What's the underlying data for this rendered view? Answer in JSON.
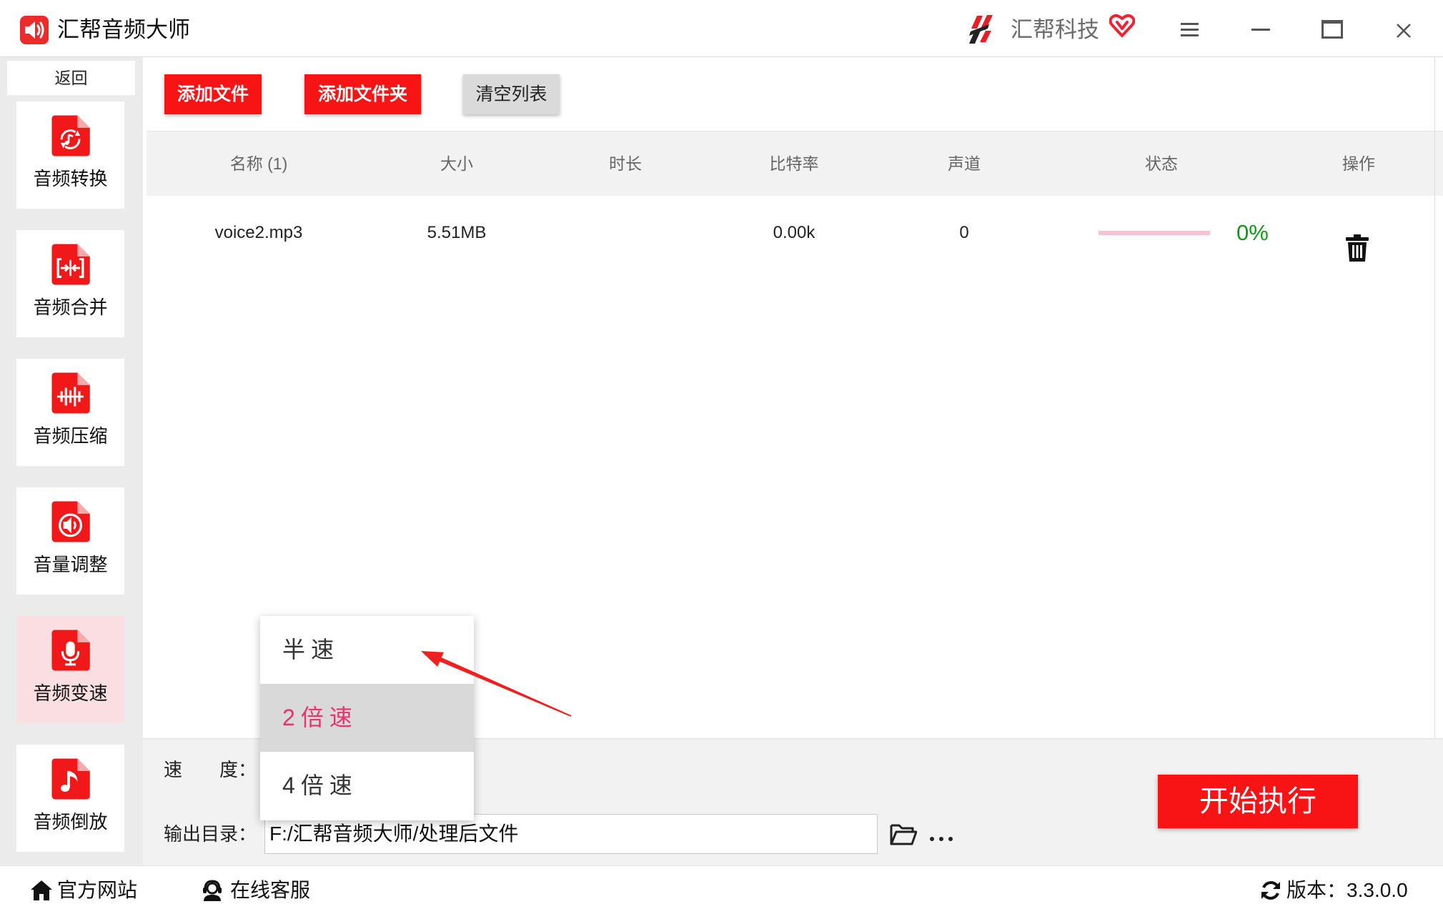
{
  "app": {
    "title": "汇帮音频大师",
    "brand": "汇帮科技"
  },
  "window_controls": [
    "menu-icon",
    "minimize-icon",
    "maximize-icon",
    "close-icon"
  ],
  "sidebar": {
    "back_label": "返回",
    "active_index": 4,
    "items": [
      {
        "label": "音频转换",
        "icon": "audio-convert-icon"
      },
      {
        "label": "音频合并",
        "icon": "audio-merge-icon"
      },
      {
        "label": "音频压缩",
        "icon": "audio-compress-icon"
      },
      {
        "label": "音量调整",
        "icon": "volume-adjust-icon"
      },
      {
        "label": "音频变速",
        "icon": "microphone-icon"
      },
      {
        "label": "音频倒放",
        "icon": "music-note-icon"
      }
    ]
  },
  "toolbar": {
    "add_file": "添加文件",
    "add_folder": "添加文件夹",
    "clear_list": "清空列表"
  },
  "table": {
    "columns": [
      "名称 (1)",
      "大小",
      "时长",
      "比特率",
      "声道",
      "状态",
      "操作"
    ],
    "rows": [
      {
        "name": "voice2.mp3",
        "size": "5.51MB",
        "duration": "",
        "bitrate": "0.00k",
        "channels": "0",
        "progress": 0,
        "progress_text": "0%",
        "action_icon": "trash-icon"
      }
    ]
  },
  "settings": {
    "speed_label": "速　　度：",
    "speed_options": [
      "半速",
      "2倍速",
      "4倍速"
    ],
    "highlighted_index": 1,
    "output_label": "输出目录：",
    "output_path": "F:/汇帮音频大师/处理后文件",
    "start_button": "开始执行"
  },
  "footer": {
    "website": "官方网站",
    "support": "在线客服",
    "version_label": "版本：",
    "version": "3.3.0.0"
  },
  "colors": {
    "accent": "#f81414",
    "active_item_bg": "#fadfe2",
    "highlight_text": "#e8336d",
    "progress_track": "#f7c3d1",
    "progress_text": "#109a10"
  }
}
